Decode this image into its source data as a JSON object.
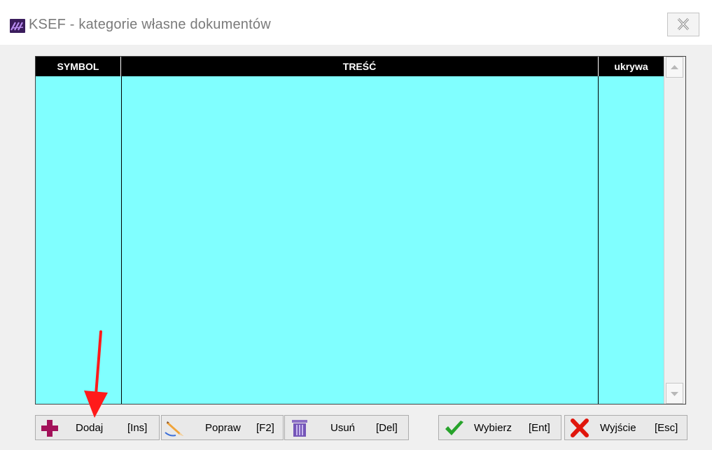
{
  "window": {
    "title": "KSEF - kategorie własne dokumentów",
    "icon": "app-logo-icon",
    "close_icon": "close-icon"
  },
  "grid": {
    "columns": [
      "SYMBOL",
      "TREŚĆ",
      "ukrywa"
    ],
    "rows": [],
    "background": "#80ffff",
    "header_background": "#000000"
  },
  "toolbar": {
    "add": {
      "label": "Dodaj",
      "shortcut": "[Ins]",
      "icon": "plus-icon"
    },
    "edit": {
      "label": "Popraw",
      "shortcut": "[F2]",
      "icon": "pencil-icon"
    },
    "delete": {
      "label": "Usuń",
      "shortcut": "[Del]",
      "icon": "trash-icon"
    },
    "select": {
      "label": "Wybierz",
      "shortcut": "[Ent]",
      "icon": "checkmark-icon"
    },
    "exit": {
      "label": "Wyjście",
      "shortcut": "[Esc]",
      "icon": "x-mark-icon"
    }
  },
  "annotation": {
    "icon": "red-arrow-icon",
    "color": "#ff1a1a"
  }
}
